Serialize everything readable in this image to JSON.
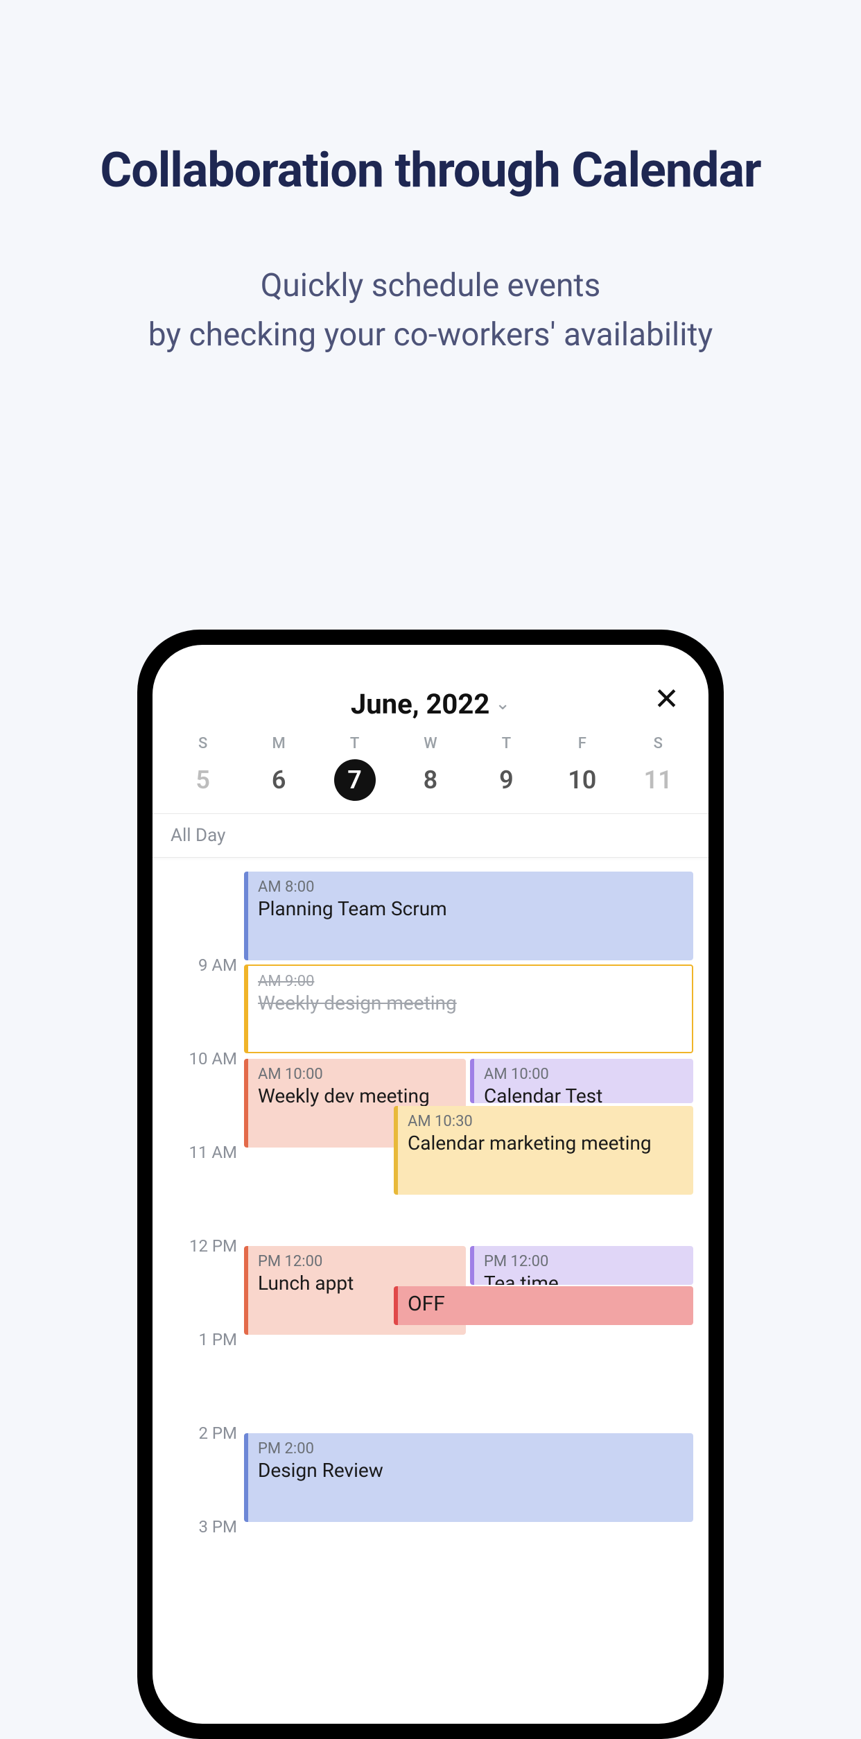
{
  "headline": "Collaboration through Calendar",
  "subhead_line1": "Quickly schedule events",
  "subhead_line2": "by checking your co-workers' availability",
  "calendar": {
    "month_title": "June, 2022",
    "allday_label": "All Day",
    "days": [
      {
        "dow": "S",
        "num": "5"
      },
      {
        "dow": "M",
        "num": "6"
      },
      {
        "dow": "T",
        "num": "7"
      },
      {
        "dow": "W",
        "num": "8"
      },
      {
        "dow": "T",
        "num": "9"
      },
      {
        "dow": "F",
        "num": "10"
      },
      {
        "dow": "S",
        "num": "11"
      }
    ],
    "hours": {
      "h9": "9 AM",
      "h10": "10 AM",
      "h11": "11 AM",
      "h12": "12 PM",
      "h13": "1 PM",
      "h14": "2 PM",
      "h15": "3 PM"
    },
    "events": {
      "planning": {
        "time": "AM 8:00",
        "title": "Planning Team Scrum"
      },
      "design": {
        "time": "AM 9:00",
        "title": "Weekly design meeting"
      },
      "dev": {
        "time": "AM 10:00",
        "title": "Weekly dev meeting"
      },
      "caltest": {
        "time": "AM 10:00",
        "title": "Calendar Test"
      },
      "marketing": {
        "time": "AM 10:30",
        "title": "Calendar marketing meeting"
      },
      "lunch": {
        "time": "PM 12:00",
        "title": "Lunch appt"
      },
      "tea": {
        "time": "PM 12:00",
        "title": "Tea time"
      },
      "off": {
        "title": "OFF"
      },
      "review": {
        "time": "PM 2:00",
        "title": "Design Review"
      }
    }
  }
}
